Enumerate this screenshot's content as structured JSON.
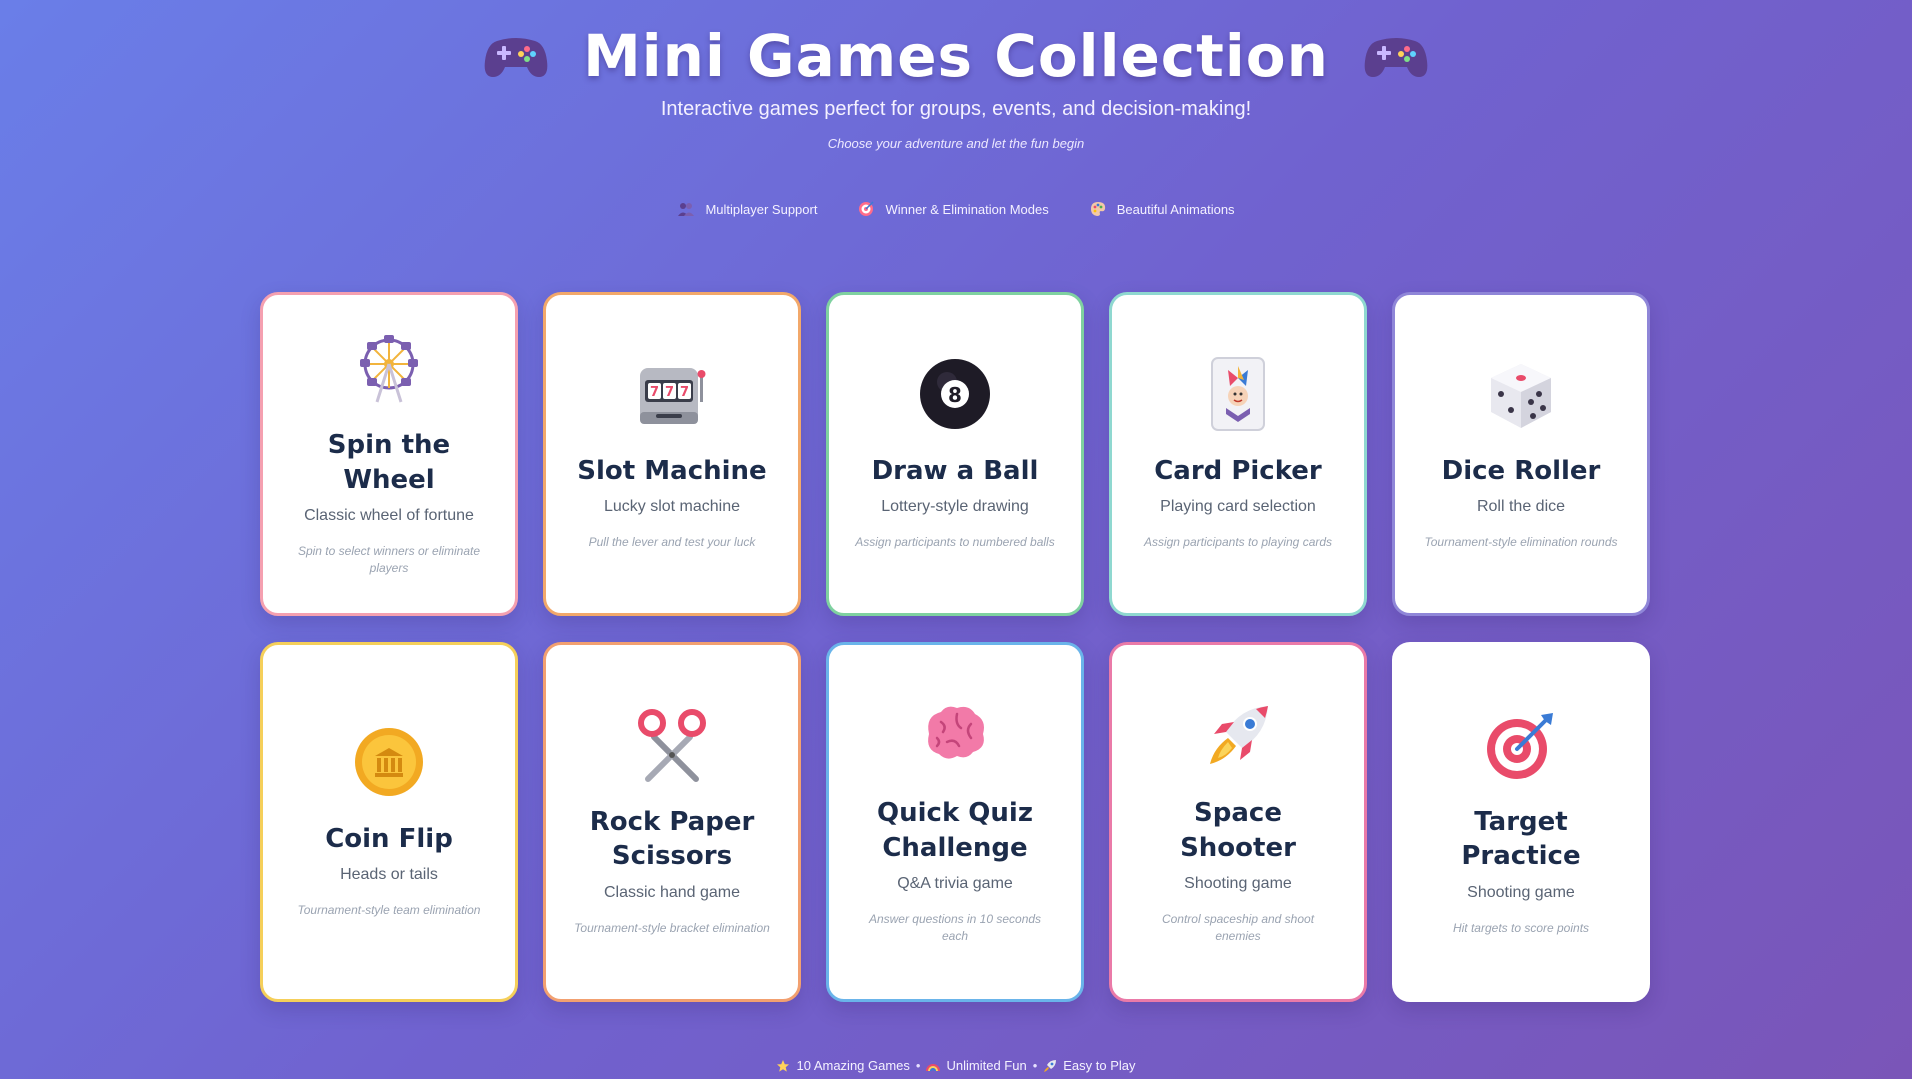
{
  "header": {
    "title": "Mini Games Collection",
    "title_icon": "game-controller-icon",
    "subtitle": "Interactive games perfect for groups, events, and decision-making!",
    "tagline": "Choose your adventure and let the fun begin"
  },
  "features": [
    {
      "icon": "people-icon",
      "label": "Multiplayer Support"
    },
    {
      "icon": "target-icon",
      "label": "Winner & Elimination Modes"
    },
    {
      "icon": "palette-icon",
      "label": "Beautiful Animations"
    }
  ],
  "games": [
    {
      "icon": "ferris-wheel-icon",
      "title": "Spin the Wheel",
      "subtitle": "Classic wheel of fortune",
      "description": "Spin to select winners or eliminate players",
      "accent": "#f5a0b0"
    },
    {
      "icon": "slot-machine-icon",
      "title": "Slot Machine",
      "subtitle": "Lucky slot machine",
      "description": "Pull the lever and test your luck",
      "accent": "#f2a86a"
    },
    {
      "icon": "pool-8-ball-icon",
      "title": "Draw a Ball",
      "subtitle": "Lottery-style drawing",
      "description": "Assign participants to numbered balls",
      "accent": "#7fd1a0"
    },
    {
      "icon": "joker-card-icon",
      "title": "Card Picker",
      "subtitle": "Playing card selection",
      "description": "Assign participants to playing cards",
      "accent": "#8fd8d0"
    },
    {
      "icon": "dice-icon",
      "title": "Dice Roller",
      "subtitle": "Roll the dice",
      "description": "Tournament-style elimination rounds",
      "accent": "#8f86d8"
    },
    {
      "icon": "coin-icon",
      "title": "Coin Flip",
      "subtitle": "Heads or tails",
      "description": "Tournament-style team elimination",
      "accent": "#f5cf5a"
    },
    {
      "icon": "scissors-icon",
      "title": "Rock Paper Scissors",
      "subtitle": "Classic hand game",
      "description": "Tournament-style bracket elimination",
      "accent": "#f2a070"
    },
    {
      "icon": "brain-icon",
      "title": "Quick Quiz Challenge",
      "subtitle": "Q&A trivia game",
      "description": "Answer questions in 10 seconds each",
      "accent": "#6ab4ea"
    },
    {
      "icon": "rocket-icon",
      "title": "Space Shooter",
      "subtitle": "Shooting game",
      "description": "Control spaceship and shoot enemies",
      "accent": "#ea7aa8"
    },
    {
      "icon": "bullseye-icon",
      "title": "Target Practice",
      "subtitle": "Shooting game",
      "description": "Hit targets to score points",
      "accent": "#ffffff"
    }
  ],
  "footer": [
    {
      "icon": "star-icon",
      "label": "10 Amazing Games"
    },
    {
      "icon": "rainbow-icon",
      "label": "Unlimited Fun"
    },
    {
      "icon": "rocket-icon",
      "label": "Easy to Play"
    }
  ],
  "footer_separator": "•"
}
